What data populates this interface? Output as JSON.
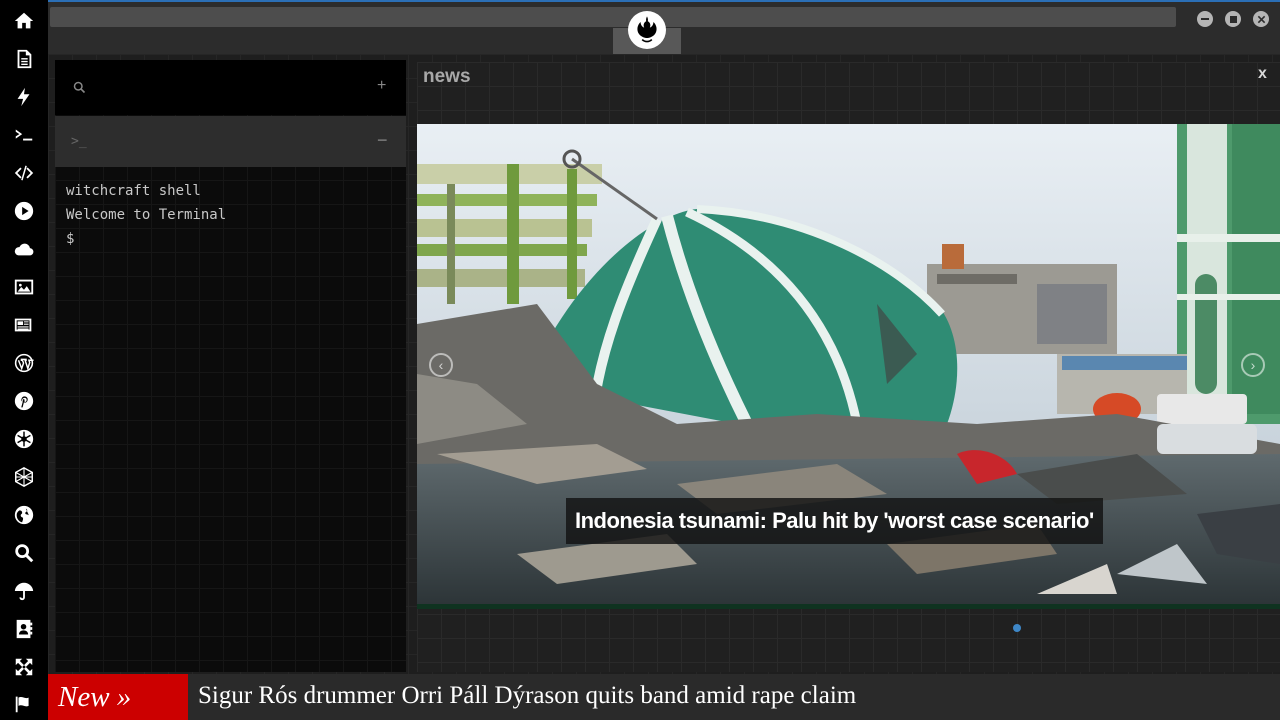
{
  "iconbar": {
    "icons": [
      "home-icon",
      "document-icon",
      "lightning-icon",
      "terminal-icon",
      "code-icon",
      "play-icon",
      "cloud-icon",
      "image-icon",
      "newspaper-icon",
      "wordpress-icon",
      "pinterest-icon",
      "aperture-icon",
      "network-icon",
      "globe-icon",
      "search-icon",
      "umbrella-icon",
      "contact-card-icon",
      "expand-icon",
      "flag-icon"
    ]
  },
  "window": {
    "logo": "rebel-alliance-icon",
    "buttons": [
      "minimize-icon",
      "maximize-icon",
      "close-icon"
    ]
  },
  "terminal": {
    "search_icon": "search-icon",
    "add_label": "+",
    "tab_prompt": ">_",
    "collapse_label": "−",
    "lines": [
      "witchcraft shell",
      "Welcome to Terminal",
      "$"
    ]
  },
  "news": {
    "title": "news",
    "close_label": "x",
    "headline": "Indonesia tsunami: Palu hit by 'worst case scenario'",
    "prev_label": "‹",
    "next_label": "›",
    "accent_color": "#3e87c7"
  },
  "ticker": {
    "badge": "New »",
    "text": "Sigur Rós drummer Orri Páll Dýrason quits band amid rape claim",
    "badge_color": "#cc0000"
  }
}
